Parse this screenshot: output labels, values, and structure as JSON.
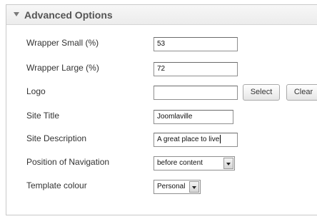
{
  "panel": {
    "title": "Advanced Options",
    "toggle_icon": "collapse-arrow-icon"
  },
  "fields": {
    "wrapper_small": {
      "label": "Wrapper Small (%)",
      "value": "53"
    },
    "wrapper_large": {
      "label": "Wrapper Large (%)",
      "value": "72"
    },
    "logo": {
      "label": "Logo",
      "value": "",
      "select_label": "Select",
      "clear_label": "Clear"
    },
    "site_title": {
      "label": "Site Title",
      "value": "Joomlaville"
    },
    "site_description": {
      "label": "Site Description",
      "value": "A great place to live"
    },
    "navigation_position": {
      "label": "Position of Navigation",
      "selected": "before content"
    },
    "template_colour": {
      "label": "Template colour",
      "selected": "Personal"
    }
  }
}
